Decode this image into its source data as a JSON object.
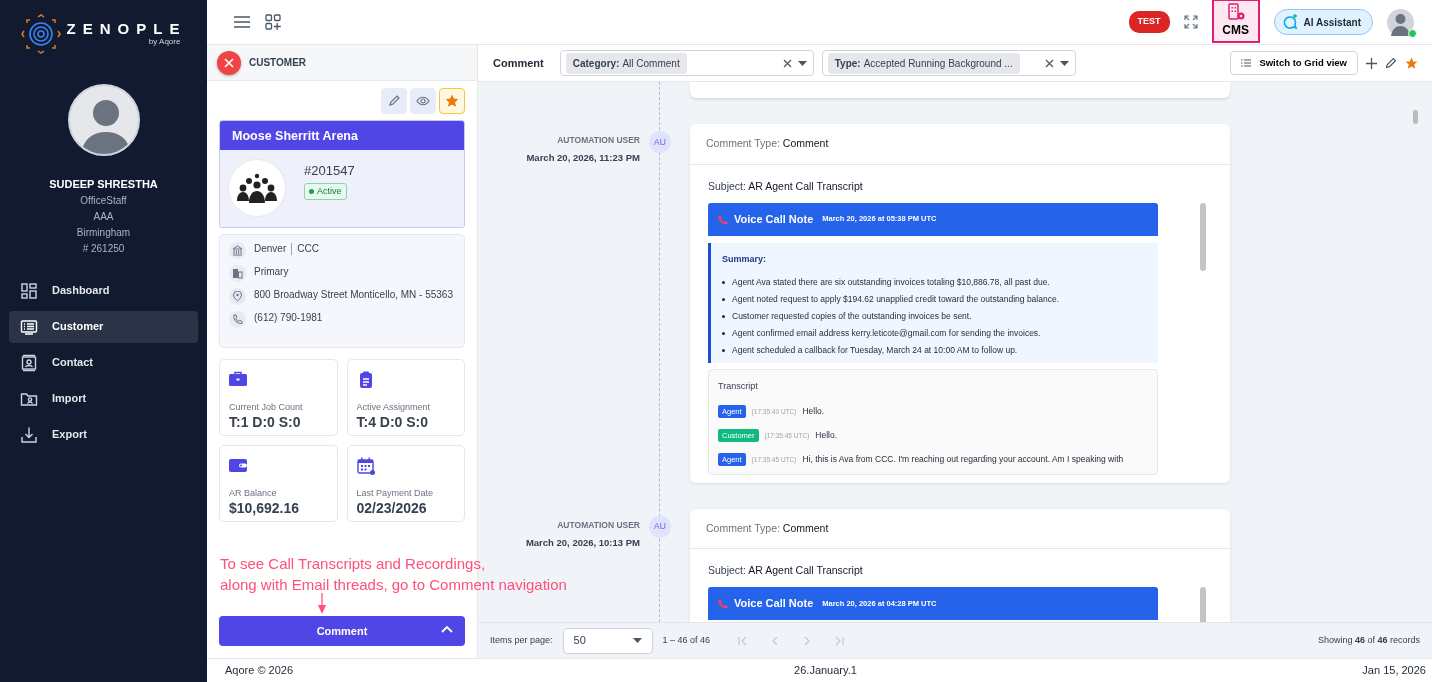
{
  "sidebar": {
    "logo": {
      "name": "ZENOPLE",
      "tagline": "by Aqore"
    },
    "user": {
      "name": "SUDEEP SHRESTHA",
      "details": [
        "OfficeStaff",
        "AAA",
        "Birmingham",
        "# 261250"
      ]
    },
    "nav": [
      {
        "label": "Dashboard",
        "kind": "dashboard",
        "selected": false
      },
      {
        "label": "Customer",
        "kind": "customer",
        "selected": true
      },
      {
        "label": "Contact",
        "kind": "contact",
        "selected": false
      },
      {
        "label": "Import",
        "kind": "import",
        "selected": false
      },
      {
        "label": "Export",
        "kind": "export",
        "selected": false
      }
    ]
  },
  "topbar": {
    "env_badge": "TEST",
    "cms_label": "CMS",
    "ai_button": "AI Assistant",
    "user_online": true
  },
  "customer_panel": {
    "header": "CUSTOMER",
    "favorite": true,
    "customer": {
      "name": "Moose Sherritt Arena",
      "number": "#201547",
      "status": "Active"
    },
    "details": [
      {
        "kind": "office",
        "parts": [
          "Denver",
          "CCC"
        ]
      },
      {
        "kind": "building",
        "parts": [
          "Primary"
        ]
      },
      {
        "kind": "location",
        "parts": [
          "800 Broadway Street Monticello, MN - 55363"
        ]
      },
      {
        "kind": "phone",
        "parts": [
          "(612) 790-1981"
        ]
      }
    ],
    "stats": [
      {
        "kind": "briefcase",
        "label": "Current Job Count",
        "value": "T:1 D:0 S:0"
      },
      {
        "kind": "clipboard",
        "label": "Active Assignment",
        "value": "T:4 D:0 S:0"
      },
      {
        "kind": "wallet",
        "label": "AR Balance",
        "value": "$10,692.16"
      },
      {
        "kind": "calendar",
        "label": "Last Payment Date",
        "value": "02/23/2026"
      }
    ],
    "annotation": [
      "To see Call Transcripts and Recordings,",
      "along with Email threads, go to Comment navigation"
    ],
    "comment_button": "Comment"
  },
  "comments": {
    "title": "Comment",
    "filters": [
      {
        "label": "Category:",
        "value": "All Comment"
      },
      {
        "label": "Type:",
        "value": "Accepted Running Background ..."
      }
    ],
    "grid_button": "Switch to Grid view",
    "entries": [
      {
        "author": "AUTOMATION USER",
        "date": "March 20, 2026, 11:23 PM",
        "initials": "AU",
        "type_label": "Comment Type:",
        "type": "Comment",
        "subject_label": "Subject:",
        "subject": "AR Agent Call Transcript",
        "note": {
          "title": "Voice Call Note",
          "date": "March 20, 2026 at 05:38 PM UTC",
          "summary_title": "Summary:",
          "summary": [
            "Agent Ava stated there are six outstanding invoices totaling $10,886.78, all past due.",
            "Agent noted request to apply $194.62 unapplied credit toward the outstanding balance.",
            "Customer requested copies of the outstanding invoices be sent.",
            "Agent confirmed email address kerry.leticote@gmail.com for sending the invoices.",
            "Agent scheduled a callback for Tuesday, March 24 at 10:00 AM to follow up."
          ],
          "transcript_title": "Transcript",
          "transcript": [
            {
              "speaker": "Agent",
              "kind": "agent",
              "time": "(17:35:40 UTC)",
              "text": "Hello."
            },
            {
              "speaker": "Customer",
              "kind": "customer",
              "time": "(17:35:45 UTC)",
              "text": "Hello."
            },
            {
              "speaker": "Agent",
              "kind": "agent",
              "time": "(17:35:45 UTC)",
              "text": "Hi, this is Ava from CCC. I'm reaching out regarding your account. Am I speaking with"
            }
          ]
        }
      },
      {
        "author": "AUTOMATION USER",
        "date": "March 20, 2026, 10:13 PM",
        "initials": "AU",
        "type_label": "Comment Type:",
        "type": "Comment",
        "subject_label": "Subject:",
        "subject": "AR Agent Call Transcript",
        "note": {
          "title": "Voice Call Note",
          "date": "March 20, 2026 at 04:28 PM UTC"
        }
      }
    ],
    "pagination": {
      "label": "Items per page:",
      "page_size": "50",
      "range": "1 – 46 of 46",
      "summary": "Showing **46** of **46** records"
    }
  },
  "footer": {
    "left": "Aqore © 2026",
    "center": "26.January.1",
    "right": "Jan 15, 2026"
  }
}
